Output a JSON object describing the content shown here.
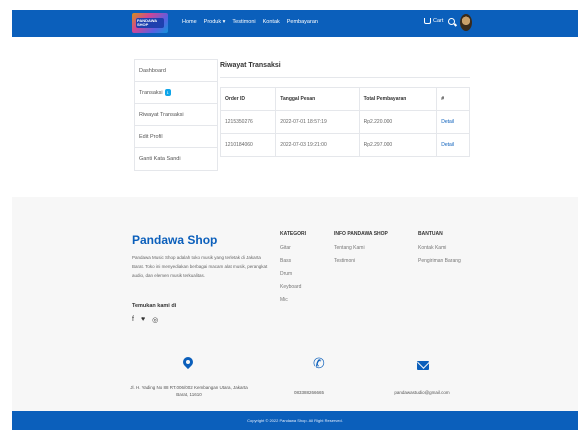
{
  "navbar": {
    "logo_text": "PANDAWA SHOP",
    "links": [
      "Home",
      "Produk ▾",
      "Testimoni",
      "Kontak",
      "Pembayaran"
    ],
    "cart_label": "Cart"
  },
  "sidebar": {
    "items": [
      {
        "label": "Dashboard"
      },
      {
        "label": "Transaksi",
        "badge": "1"
      },
      {
        "label": "Riwayat Transaksi"
      },
      {
        "label": "Edit Profil"
      },
      {
        "label": "Ganti Kata Sandi"
      }
    ]
  },
  "main": {
    "title": "Riwayat Transaksi",
    "columns": [
      "Order ID",
      "Tanggal Pesan",
      "Total Pembayaran",
      "#"
    ],
    "rows": [
      [
        "1215350276",
        "2022-07-01 18:57:19",
        "Rp2.220.000",
        "Detail"
      ],
      [
        "1210184060",
        "2022-07-03 19:21:00",
        "Rp2.297.000",
        "Detail"
      ]
    ]
  },
  "footer": {
    "brand": "Pandawa Shop",
    "description": "Pandawa Music Shop adalah toko musik yang terletak di Jakarta Barat. Toko ini menyediakan berbagai macam alat musik, perangkat audio, dan elemen musik terkualitas.",
    "find_us": "Temukan kami di",
    "social_icons": [
      "facebook-icon",
      "twitter-icon",
      "instagram-icon"
    ],
    "kategori": {
      "heading": "KATEGORI",
      "items": [
        "Gitar",
        "Bass",
        "Drum",
        "Keyboard",
        "Mic"
      ]
    },
    "info": {
      "heading": "INFO PANDAWA SHOP",
      "items": [
        "Tentang Kami",
        "Testimoni"
      ]
    },
    "bantuan": {
      "heading": "BANTUAN",
      "items": [
        "Kontak Kami",
        "Pengiriman Barang"
      ]
    },
    "address": "Jl. H. Yading No 88 RT.006/002 Kembangan Utara, Jakarta Barat, 11610",
    "phone": "083388266665",
    "email": "pandawastudio@gmail.com",
    "copyright": "Copyright © 2022 Pandawa Shop. All Right Reserved."
  }
}
